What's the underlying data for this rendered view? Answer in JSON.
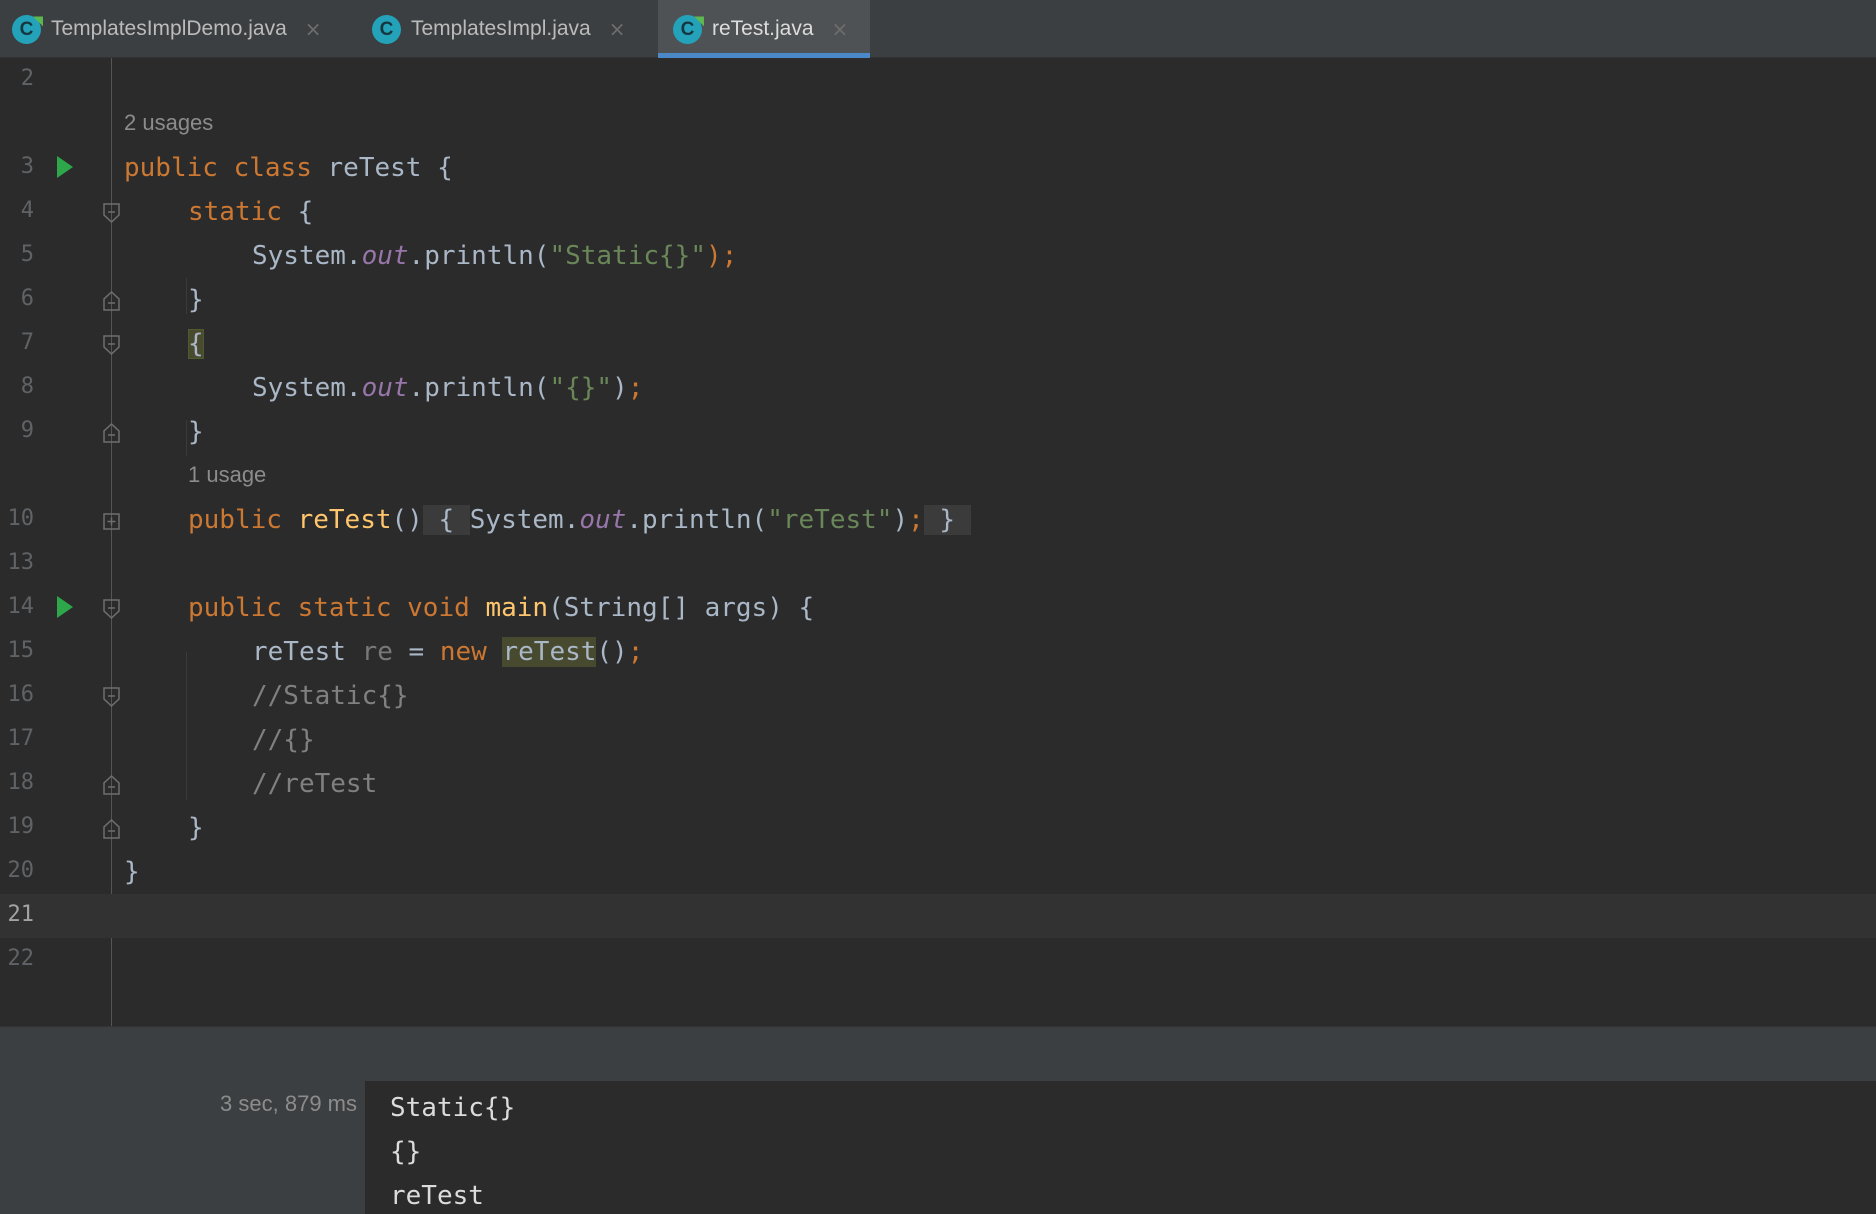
{
  "tabs": [
    {
      "label": "TemplatesImplDemo.java",
      "close": "×",
      "icon": "class-icon-run"
    },
    {
      "label": "TemplatesImpl.java",
      "close": "×",
      "icon": "class-icon"
    },
    {
      "label": "reTest.java",
      "close": "×",
      "icon": "class-icon-run",
      "active": true
    }
  ],
  "editor": {
    "hints": {
      "class_usages": "2 usages",
      "ctor_usages": "1 usage"
    },
    "lines": [
      {
        "num": "2"
      },
      {
        "num": "3",
        "t": [
          "public",
          "class",
          "reTest",
          "{"
        ]
      },
      {
        "num": "4",
        "t": [
          "static",
          "{"
        ]
      },
      {
        "num": "5",
        "t": [
          "System.",
          "out",
          ".println(",
          "\"Static{}\"",
          ");",
          ";"
        ]
      },
      {
        "num": "6",
        "t": [
          "}"
        ]
      },
      {
        "num": "7",
        "t": [
          "{"
        ]
      },
      {
        "num": "8",
        "t": [
          "System.",
          "out",
          ".println(",
          "\"{}\"",
          ")",
          ";"
        ]
      },
      {
        "num": "9",
        "t": [
          "}"
        ]
      },
      {
        "num": "10",
        "t": [
          "public",
          "reTest",
          "()",
          "{",
          "System.",
          "out",
          ".println(",
          "\"reTest\"",
          ")",
          ";",
          "}"
        ]
      },
      {
        "num": "13"
      },
      {
        "num": "14",
        "t": [
          "public",
          "static",
          "void",
          "main",
          "(String[] args) {"
        ]
      },
      {
        "num": "15",
        "t": [
          "reTest",
          "re",
          "=",
          "new",
          "reTest",
          "()",
          ";"
        ]
      },
      {
        "num": "16",
        "t": [
          "//Static{}"
        ]
      },
      {
        "num": "17",
        "t": [
          "//{}"
        ]
      },
      {
        "num": "18",
        "t": [
          "//reTest"
        ]
      },
      {
        "num": "19",
        "t": [
          "}"
        ]
      },
      {
        "num": "20",
        "t": [
          "}"
        ]
      },
      {
        "num": "21"
      },
      {
        "num": "22"
      }
    ],
    "current_line": "21",
    "colors": {
      "keyword": "#cc7832",
      "method": "#ffc66d",
      "static_field": "#9876aa",
      "string": "#6a8759",
      "comment": "#808080",
      "text": "#a9b7c6"
    }
  },
  "run": {
    "duration": "3 sec, 879 ms",
    "output": [
      "Static{}",
      "{}",
      "reTest"
    ]
  }
}
